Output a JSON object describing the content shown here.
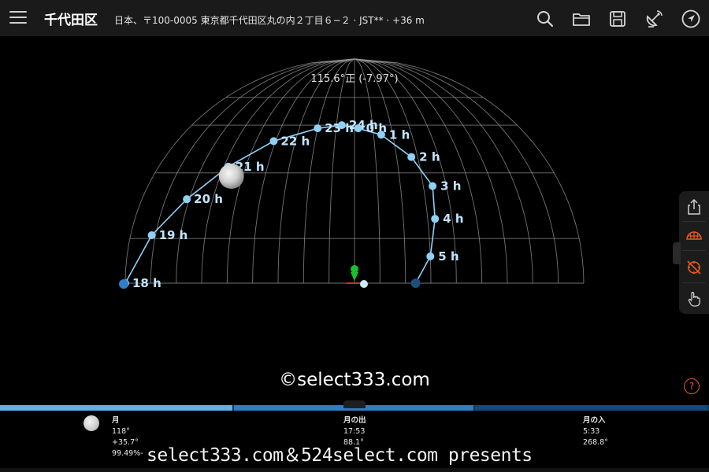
{
  "header": {
    "title": "千代田区",
    "location": "日本、〒100-0005 東京都千代田区丸の内２丁目６−２ · JST** · +36 m"
  },
  "toolbar": {
    "icons": [
      "menu-icon",
      "search-icon",
      "folder-icon",
      "save-icon",
      "satellite-dish-icon",
      "navigation-arrow-icon"
    ]
  },
  "sky": {
    "readout": "115.6°正 (-7.97°)",
    "moon_path": {
      "evening": [
        {
          "label": "18 h",
          "az": -90.5,
          "alt": 0
        },
        {
          "label": "19 h",
          "az": -81.5,
          "alt": 11
        },
        {
          "label": "20 h",
          "az": -71,
          "alt": 22
        },
        {
          "label": "21 h",
          "az": -58,
          "alt": 32
        },
        {
          "label": "22 h",
          "az": -41,
          "alt": 40
        },
        {
          "label": "23 h",
          "az": -20,
          "alt": 44
        },
        {
          "label": "24 h",
          "az": -7,
          "alt": 45
        }
      ],
      "morning": [
        {
          "label": "0 h",
          "az": 2,
          "alt": 44
        },
        {
          "label": "1 h",
          "az": 14,
          "alt": 42
        },
        {
          "label": "2 h",
          "az": 27,
          "alt": 35
        },
        {
          "label": "3 h",
          "az": 34,
          "alt": 26
        },
        {
          "label": "4 h",
          "az": 33,
          "alt": 16
        },
        {
          "label": "5 h",
          "az": 30,
          "alt": 6
        }
      ]
    },
    "current_moon": {
      "az": -55,
      "alt": 29
    },
    "moonrise_marker": {
      "az": -90.5,
      "alt": 0
    },
    "moonset_marker": {
      "az": 24,
      "alt": 0
    },
    "observer_marker": {
      "az": 0,
      "alt": 0
    }
  },
  "side_panel": {
    "icons": [
      "share-icon",
      "dome-grid-icon",
      "compass-off-icon",
      "hand-pointer-icon"
    ]
  },
  "help_label": "?",
  "watermark": "©select333.com",
  "timeline": {
    "segments": [
      {
        "from": 0,
        "to": 0.33,
        "color": "#5fb0ea"
      },
      {
        "from": 0.33,
        "to": 0.67,
        "color": "#2c7fc6"
      },
      {
        "from": 0.67,
        "to": 1.0,
        "color": "#124a7e"
      }
    ]
  },
  "info": {
    "moon": {
      "title": "月",
      "line1": "118°",
      "line2": "+35.7°",
      "line3": "99.49%-"
    },
    "rise": {
      "title": "月の出",
      "line1": "17:53",
      "line2": "88.1°"
    },
    "set": {
      "title": "月の入",
      "line1": "5:33",
      "line2": "268.8°"
    }
  },
  "presents_text": "select333.com＆524select.com presents",
  "colors": {
    "path": "#8fd0f7",
    "grid": "#9a9a9a",
    "accent_orange": "#e85a1e",
    "observer_green": "#18c22a"
  }
}
